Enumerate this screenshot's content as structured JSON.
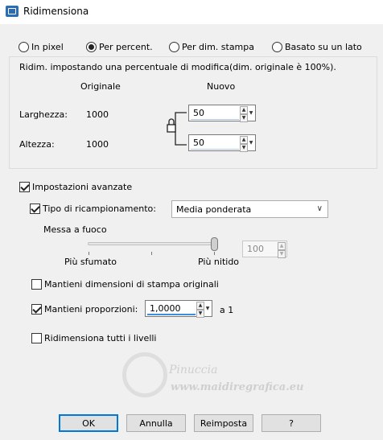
{
  "window": {
    "title": "Ridimensiona"
  },
  "mode": {
    "options": [
      {
        "label": "In pixel",
        "checked": false
      },
      {
        "label": "Per percent.",
        "checked": true
      },
      {
        "label": "Per dim. stampa",
        "checked": false
      },
      {
        "label": "Basato su un lato",
        "checked": false
      }
    ]
  },
  "size_group": {
    "description": "Ridim. impostando una percentuale di modifica(dim. originale è 100%).",
    "original_header": "Originale",
    "new_header": "Nuovo",
    "width_label": "Larghezza:",
    "width_original": "1000",
    "width_new": "50",
    "height_label": "Altezza:",
    "height_original": "1000",
    "height_new": "50"
  },
  "advanced": {
    "label": "Impostazioni avanzate",
    "checked": true,
    "resample_label": "Tipo di ricampionamento:",
    "resample_checked": true,
    "resample_value": "Media ponderata",
    "focus_label": "Messa a fuoco",
    "focus_min_label": "Più sfumato",
    "focus_max_label": "Più nitido",
    "focus_value": "100"
  },
  "options": {
    "keep_print_label": "Mantieni dimensioni di stampa originali",
    "keep_print_checked": false,
    "keep_ratio_label": "Mantieni proporzioni:",
    "keep_ratio_checked": true,
    "ratio_value": "1,0000",
    "ratio_suffix": "a 1",
    "resize_all_label": "Ridimensiona tutti i livelli",
    "resize_all_checked": false
  },
  "buttons": {
    "ok": "OK",
    "cancel": "Annulla",
    "reset": "Reimposta",
    "help": "?"
  },
  "watermark": {
    "name": "Pinuccia",
    "url": "www.maidiregrafica.eu"
  }
}
